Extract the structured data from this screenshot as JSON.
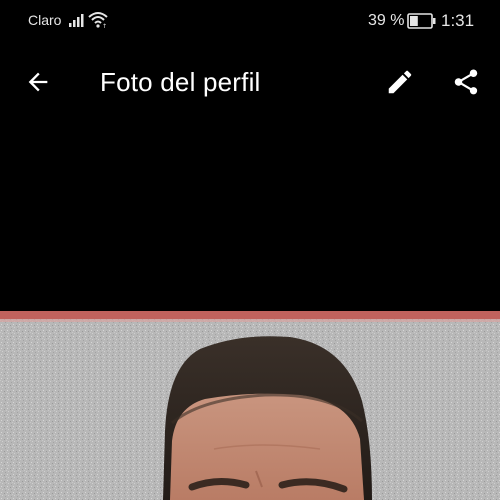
{
  "status_bar": {
    "carrier": "Claro",
    "battery_percent": "39 %",
    "battery_level": 0.39,
    "time": "1:31",
    "icons": [
      "signal-icon",
      "wifi-icon",
      "battery-icon"
    ]
  },
  "app_bar": {
    "title": "Foto del perfil",
    "icons": [
      "back-arrow-icon",
      "edit-pencil-icon",
      "share-icon"
    ]
  },
  "colors": {
    "background": "#000000",
    "text": "#ffffff",
    "wall": "#b9b9b9",
    "trim": "#c0625d",
    "skin": "#c98f76",
    "hair": "#2a211c"
  }
}
